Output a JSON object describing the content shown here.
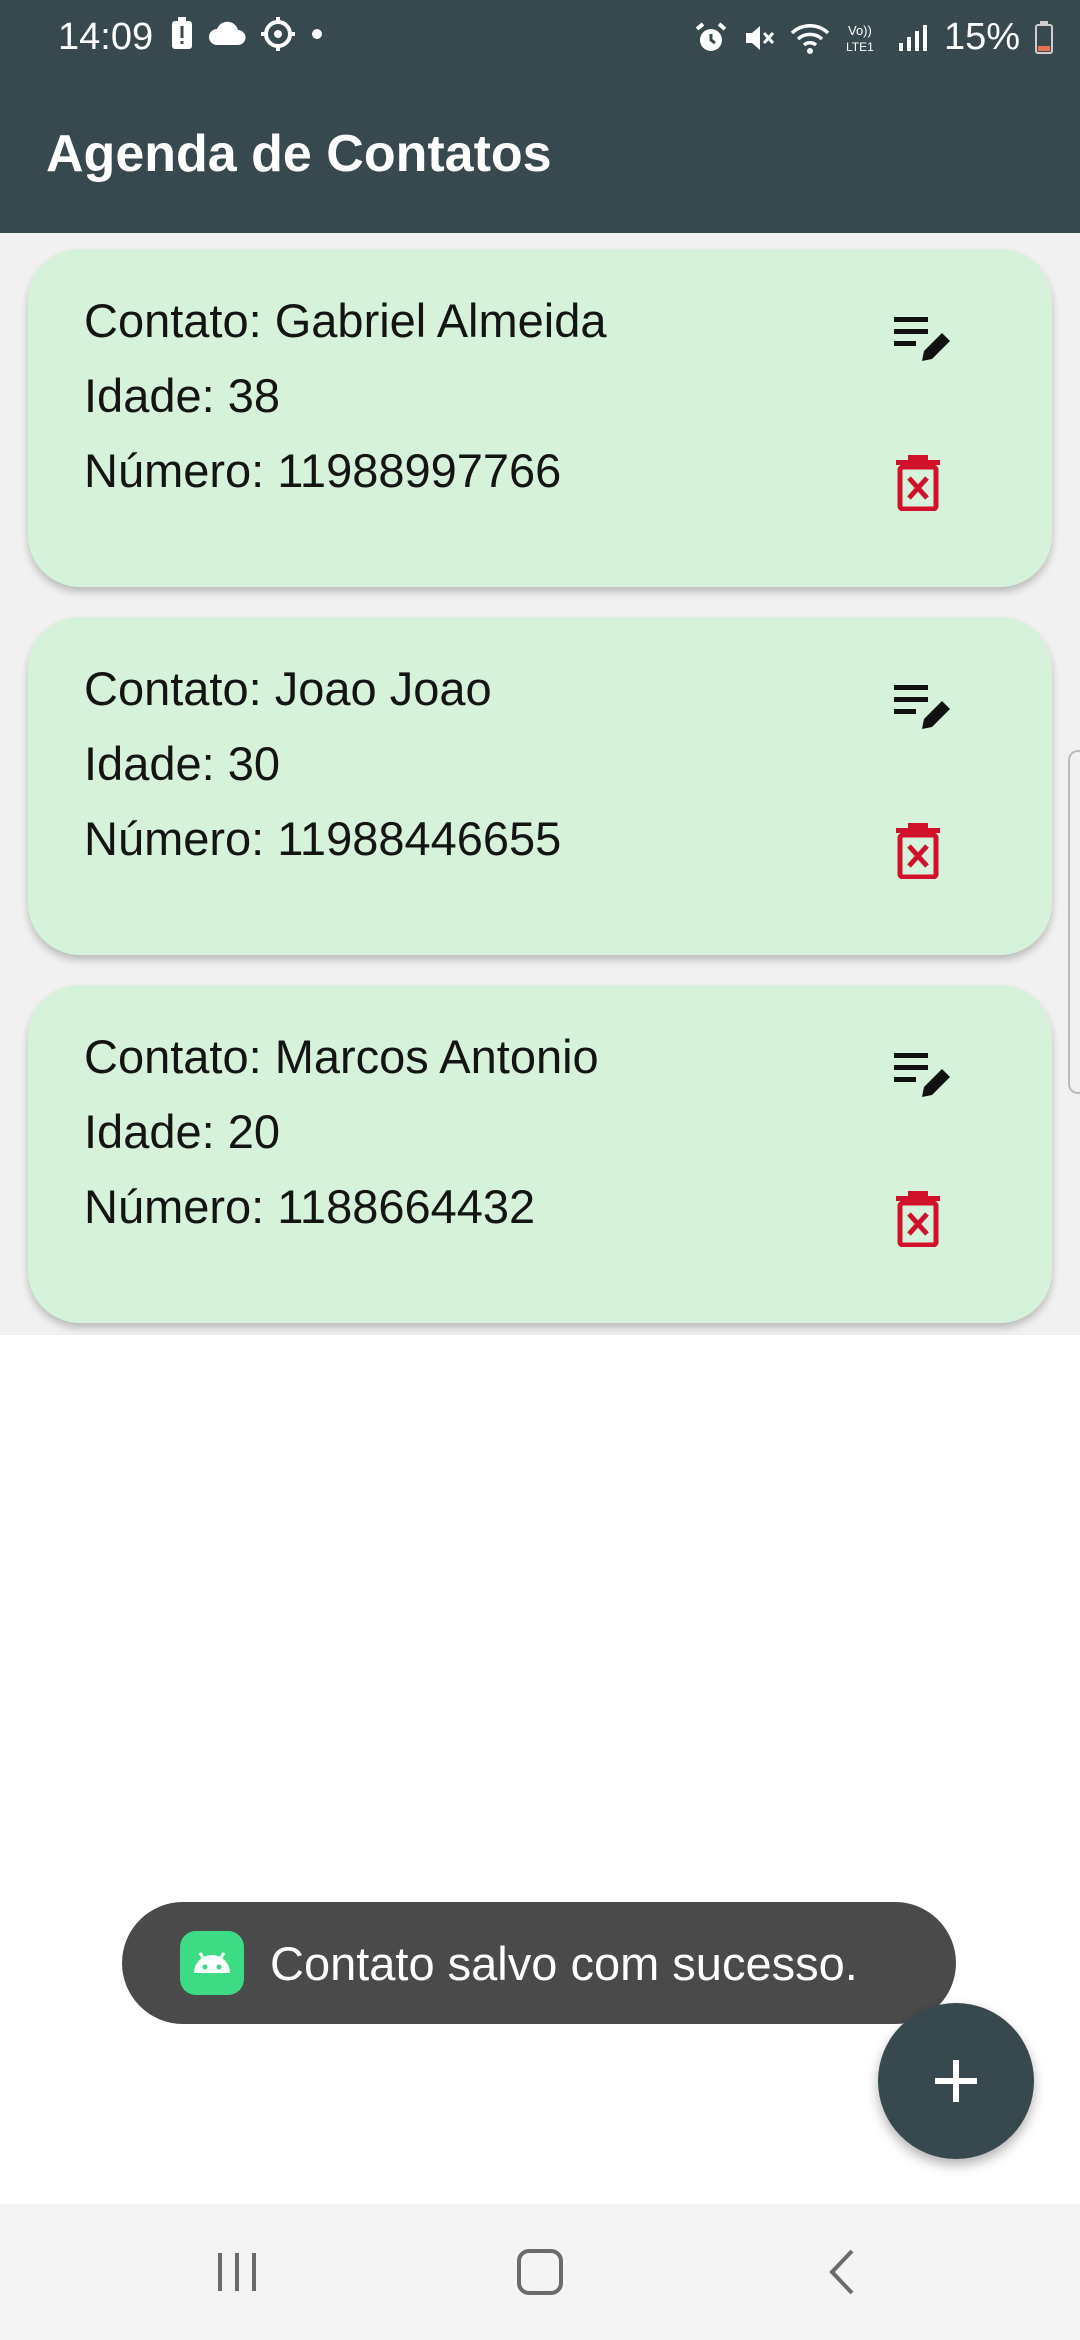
{
  "status_bar": {
    "time": "14:09",
    "battery": "15%",
    "left_icons": [
      "alert-battery-icon",
      "cloud-icon",
      "settings-icon",
      "dot-icon"
    ],
    "right_icons": [
      "alarm-icon",
      "mute-icon",
      "wifi-icon",
      "volte-icon",
      "signal-icon",
      "battery-icon"
    ]
  },
  "app_bar": {
    "title": "Agenda de Contatos"
  },
  "contacts": [
    {
      "name": "Contato: Gabriel  Almeida",
      "age": "Idade: 38",
      "number": "Número: 11988997766"
    },
    {
      "name": "Contato: Joao Joao",
      "age": "Idade: 30",
      "number": "Número: 11988446655"
    },
    {
      "name": "Contato: Marcos Antonio",
      "age": "Idade: 20",
      "number": "Número: 1188664432"
    }
  ],
  "toast": {
    "text": "Contato salvo com sucesso."
  },
  "fab": {
    "icon": "plus-icon"
  },
  "nav": {
    "icons": [
      "recents-icon",
      "home-icon",
      "back-icon"
    ]
  },
  "colors": {
    "primary": "#37494f",
    "card": "#d7f2da",
    "delete": "#d0112b",
    "toast": "#4a4a4a"
  }
}
